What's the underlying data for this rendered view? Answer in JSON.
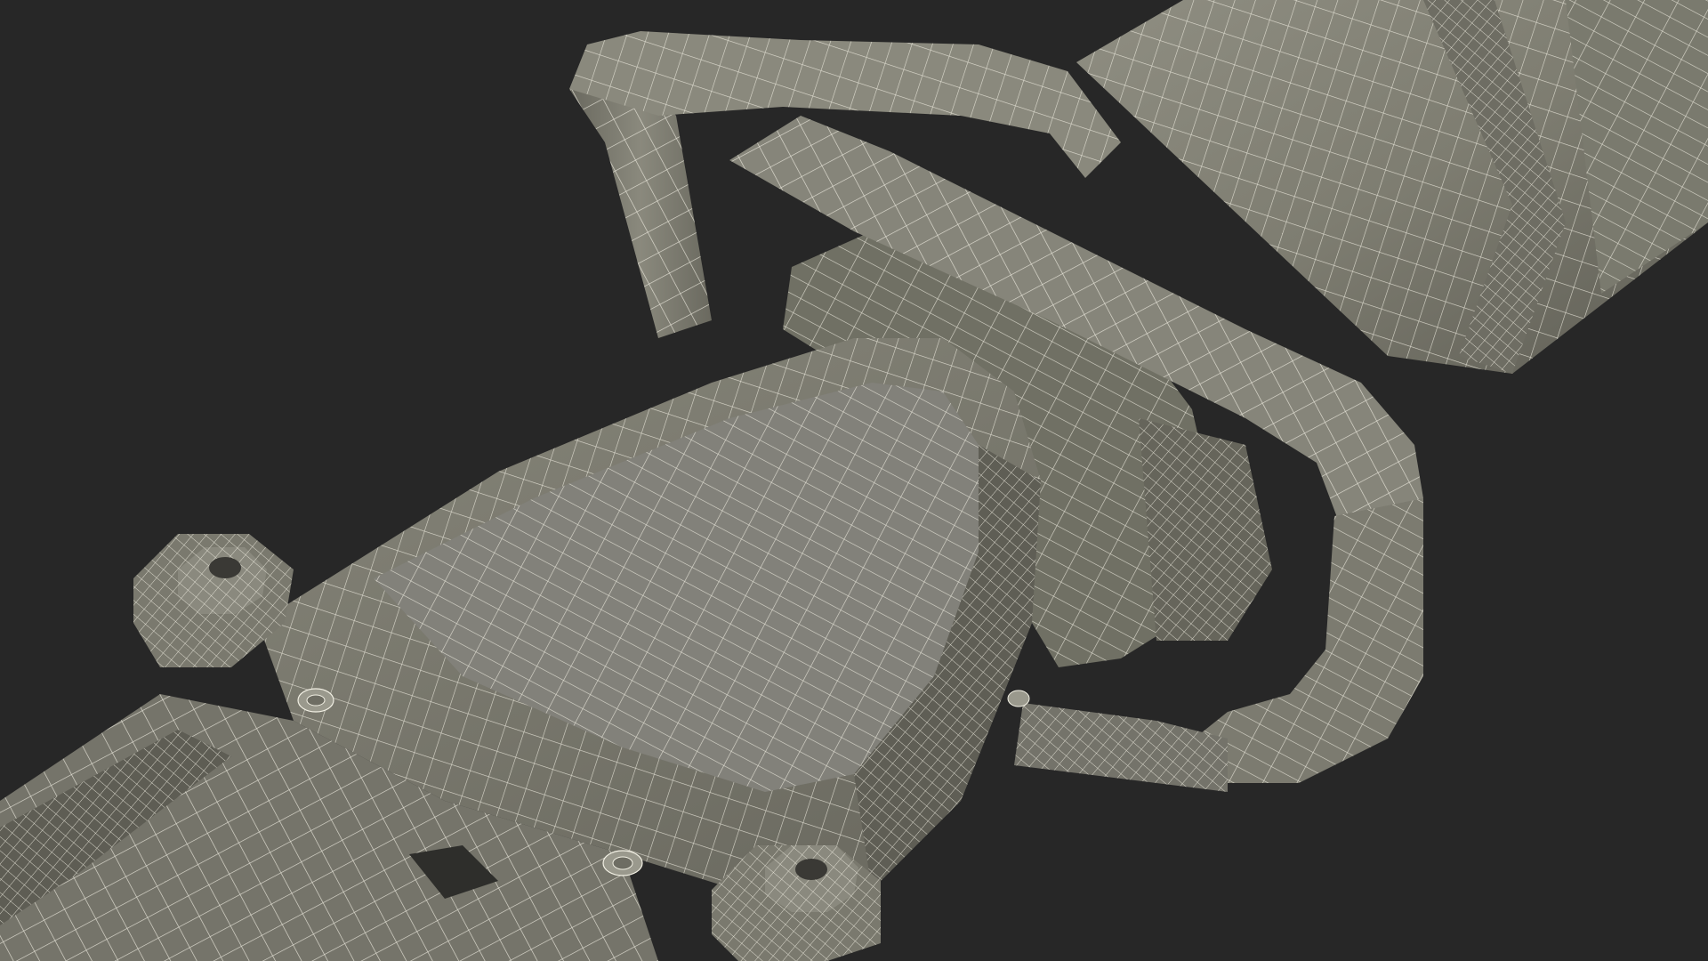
{
  "scene": {
    "subject": "wireframe-tool-model",
    "colors": {
      "background": "#272727",
      "surface": "#7e7e72",
      "surface_light": "#8d8c80",
      "surface_dark": "#5d5c53",
      "shadow": "#3c3c36",
      "wire": "#f2f0e4",
      "bolt": "#6f6e64",
      "bolt_hole": "#3a3935"
    }
  }
}
